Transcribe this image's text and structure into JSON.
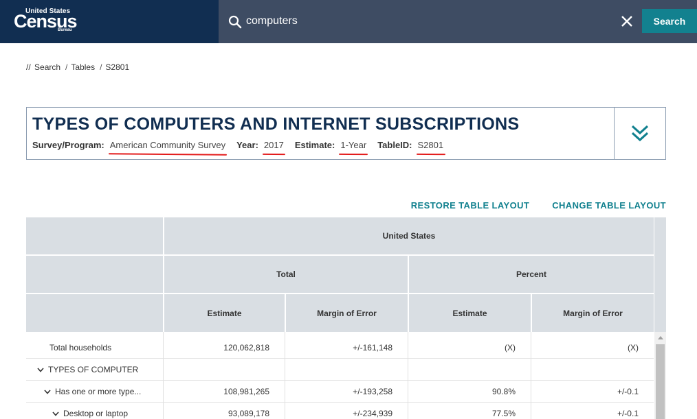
{
  "header": {
    "logo_top": "United States",
    "logo_main": "Census",
    "logo_bureau": "Bureau",
    "search_value": "computers",
    "search_button": "Search",
    "colors": {
      "logo_bg": "#112e51",
      "search_bg": "#3e4c63",
      "accent": "#12818f"
    }
  },
  "breadcrumb": {
    "root": "//",
    "items": [
      "Search",
      "Tables",
      "S2801"
    ]
  },
  "title_card": {
    "title": "TYPES OF COMPUTERS AND INTERNET SUBSCRIPTIONS",
    "survey_label": "Survey/Program:",
    "survey_value": "American Community Survey",
    "year_label": "Year:",
    "year_value": "2017",
    "estimate_label": "Estimate:",
    "estimate_value": "1-Year",
    "tableid_label": "TableID:",
    "tableid_value": "S2801",
    "expand_icon": "double-chevron-down-icon"
  },
  "layout_links": {
    "restore": "RESTORE TABLE LAYOUT",
    "change": "CHANGE TABLE LAYOUT"
  },
  "table": {
    "geo_header": "United States",
    "group_headers": [
      "Total",
      "Percent"
    ],
    "sub_headers": [
      "Estimate",
      "Margin of Error",
      "Estimate",
      "Margin of Error"
    ],
    "rows": [
      {
        "label": "Total households",
        "values": [
          "120,062,818",
          "+/-161,148",
          "(X)",
          "(X)"
        ]
      },
      {
        "label": "TYPES OF COMPUTER",
        "values": [
          "",
          "",
          "",
          ""
        ]
      },
      {
        "label": "Has one or more type...",
        "values": [
          "108,981,265",
          "+/-193,258",
          "90.8%",
          "+/-0.1"
        ]
      },
      {
        "label": "Desktop or laptop",
        "values": [
          "93,089,178",
          "+/-234,939",
          "77.5%",
          "+/-0.1"
        ]
      }
    ]
  }
}
